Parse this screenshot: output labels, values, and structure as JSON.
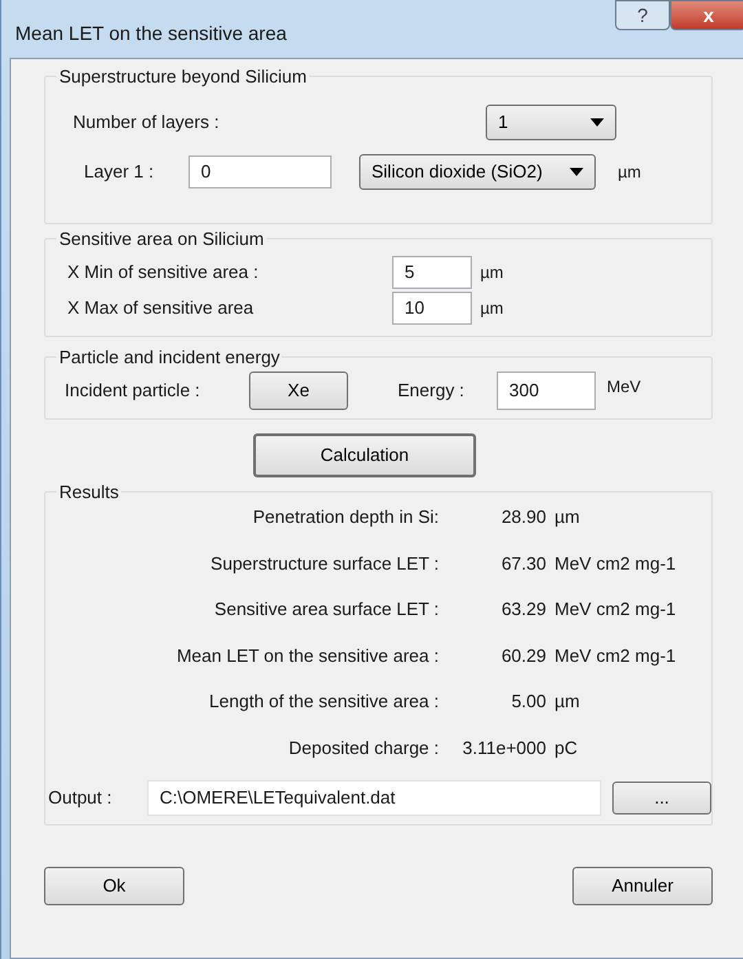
{
  "window": {
    "title": "Mean LET on the sensitive area",
    "buttons": [
      "?",
      "x"
    ]
  },
  "superstructure": {
    "title": "Superstructure beyond Silicium",
    "layers_label": "Number of layers :",
    "layers_value": "1",
    "layers": [
      {
        "label": "Layer 1 :",
        "value": "0",
        "material": "Silicon dioxide (SiO2)",
        "unit": "µm"
      }
    ]
  },
  "sensitive_area": {
    "title": "Sensitive area on Silicium",
    "fields": [
      {
        "label": "X Min of sensitive area :",
        "value": "5",
        "unit": "µm"
      },
      {
        "label": "X Max of sensitive area",
        "value": "10",
        "unit": "µm"
      }
    ]
  },
  "particle": {
    "title": "Particle and incident energy",
    "particle_label": "Incident particle :",
    "particle_button": "Xe",
    "energy_label": "Energy :",
    "energy_value": "300",
    "energy_unit": "MeV"
  },
  "calculation_button": "Calculation",
  "results": {
    "title": "Results",
    "rows": [
      {
        "label": "Penetration depth in Si:",
        "value": "28.90",
        "unit": "µm"
      },
      {
        "label": "Superstructure surface LET :",
        "value": "67.30",
        "unit": "MeV cm2 mg-1"
      },
      {
        "label": "Sensitive area surface LET :",
        "value": "63.29",
        "unit": "MeV cm2 mg-1"
      },
      {
        "label": "Mean LET on the sensitive area :",
        "value": "60.29",
        "unit": "MeV cm2 mg-1"
      },
      {
        "label": "Length of the sensitive area :",
        "value": "5.00",
        "unit": "µm"
      },
      {
        "label": "Deposited charge :",
        "value": "3.11e+000",
        "unit": "pC"
      }
    ],
    "output_label": "Output :",
    "output_value": "C:\\OMERE\\LETequivalent.dat",
    "browse_button": "..."
  },
  "buttons": [
    "Ok",
    "Annuler"
  ]
}
